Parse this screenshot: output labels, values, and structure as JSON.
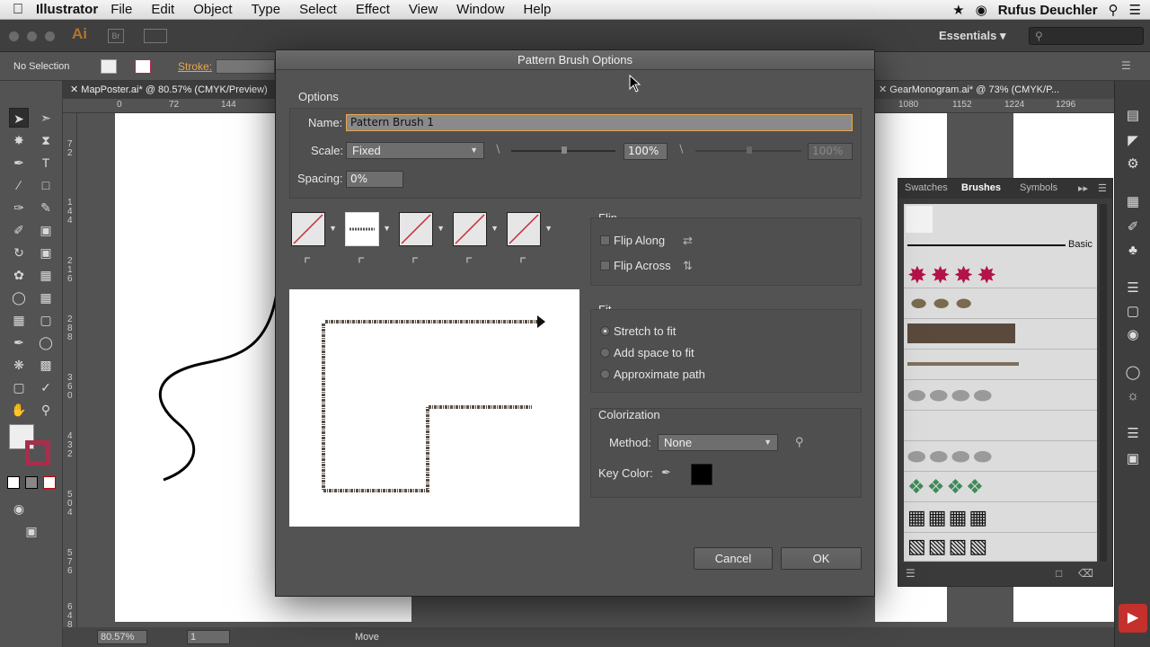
{
  "menubar": {
    "apple_icon": "apple-icon",
    "app": "Illustrator",
    "items": [
      "File",
      "Edit",
      "Object",
      "Type",
      "Select",
      "Effect",
      "View",
      "Window",
      "Help"
    ],
    "user": "Rufus Deuchler"
  },
  "appbar": {
    "logo": "Ai",
    "bridge": "Br",
    "workspace": "Essentials"
  },
  "ctrlbar": {
    "selection": "No Selection",
    "stroke_label": "Stroke:"
  },
  "tabs": {
    "left": "MapPoster.ai* @ 80.57% (CMYK/Preview)",
    "right": "GearMonogram.ai* @ 73% (CMYK/P..."
  },
  "ruler": {
    "h_left": [
      "0",
      "72",
      "144"
    ],
    "h_right": [
      "1080",
      "1152",
      "1224",
      "1296"
    ],
    "v": [
      "7 2",
      "1 4 4",
      "2 1 6",
      "2 8 8",
      "3 6 0",
      "4 3 2",
      "5 0 4",
      "5 7 6",
      "6 4 8"
    ]
  },
  "status": {
    "zoom": "80.57%",
    "page": "1",
    "tool": "Move"
  },
  "brushes_panel": {
    "tabs": [
      "Swatches",
      "Brushes",
      "Symbols"
    ],
    "active_tab": "Brushes",
    "basic_label": "Basic"
  },
  "dialog": {
    "title": "Pattern Brush Options",
    "options_label": "Options",
    "name_label": "Name:",
    "name_value": "Pattern Brush 1",
    "scale_label": "Scale:",
    "scale_value": "Fixed",
    "scale_pct": "100%",
    "scale_pct2": "100%",
    "spacing_label": "Spacing:",
    "spacing_value": "0%",
    "flip": {
      "title": "Flip",
      "along": "Flip Along",
      "across": "Flip Across"
    },
    "fit": {
      "title": "Fit",
      "options": [
        "Stretch to fit",
        "Add space to fit",
        "Approximate path"
      ],
      "selected": "Stretch to fit"
    },
    "colorization": {
      "title": "Colorization",
      "method_label": "Method:",
      "method_value": "None",
      "key_color_label": "Key Color:",
      "key_color": "#000000"
    },
    "cancel": "Cancel",
    "ok": "OK"
  },
  "colors": {
    "accent": "#e8a64c",
    "stroke_red": "#aa2d4b",
    "panel": "#535353"
  }
}
